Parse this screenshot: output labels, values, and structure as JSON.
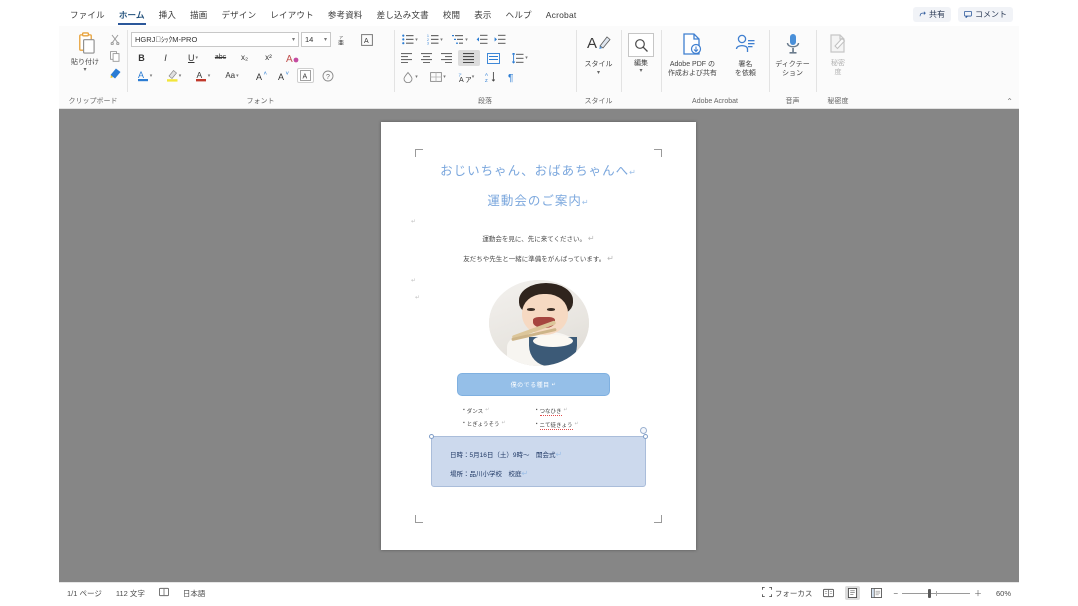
{
  "app": {
    "name": "Microsoft Word"
  },
  "tabs": [
    {
      "label": "ファイル",
      "active": false
    },
    {
      "label": "ホーム",
      "active": true
    },
    {
      "label": "挿入",
      "active": false
    },
    {
      "label": "描画",
      "active": false
    },
    {
      "label": "デザイン",
      "active": false
    },
    {
      "label": "レイアウト",
      "active": false
    },
    {
      "label": "参考資料",
      "active": false
    },
    {
      "label": "差し込み文書",
      "active": false
    },
    {
      "label": "校閲",
      "active": false
    },
    {
      "label": "表示",
      "active": false
    },
    {
      "label": "ヘルプ",
      "active": false
    },
    {
      "label": "Acrobat",
      "active": false
    }
  ],
  "tabbar_right": {
    "share_label": "共有",
    "comment_label": "コメント"
  },
  "ribbon": {
    "clipboard": {
      "group_label": "クリップボード",
      "paste_label": "貼り付け",
      "cut_name": "cut-icon",
      "copy_name": "copy-icon",
      "format_painter_name": "format-painter-icon"
    },
    "font": {
      "group_label": "フォント",
      "font_name": "HGRJ゙ｼｯｸM-PRO",
      "font_size": "14",
      "bold": "B",
      "italic": "I",
      "underline": "U",
      "strikethrough": "abc",
      "subscript": "x₂",
      "superscript": "x²",
      "text_effects": "A",
      "font_color": "A",
      "highlight": "✎",
      "char_shading": "A",
      "change_case": "Aa",
      "grow_font": "A",
      "shrink_font": "A",
      "enclose_char": "A",
      "clear_formatting": "?"
    },
    "paragraph": {
      "group_label": "段落",
      "bullets": "bullets-icon",
      "numbering": "numbering-icon",
      "multilevel": "multilevel-list-icon",
      "decrease_indent": "decrease-indent-icon",
      "increase_indent": "increase-indent-icon",
      "align_left": "align-left-icon",
      "align_center": "align-center-icon",
      "align_right": "align-right-icon",
      "justify": "justify-icon",
      "distribute": "distribute-icon",
      "line_spacing": "line-spacing-icon",
      "shading": "shading-icon",
      "borders": "borders-icon",
      "phonetic": "phonetic-guide-icon",
      "sort": "sort-icon",
      "show_marks": "show-paragraph-marks-icon"
    },
    "styles": {
      "group_label": "スタイル",
      "button_label": "スタイル"
    },
    "editing": {
      "group_label": "",
      "button_label": "編集"
    },
    "acrobat": {
      "group_label": "Adobe Acrobat",
      "create_pdf_label": "Adobe PDF の\n作成および共有",
      "create_pdf_line1": "Adobe PDF の",
      "create_pdf_line2": "作成および共有",
      "sign_line1": "署名",
      "sign_line2": "を依頼"
    },
    "voice": {
      "group_label": "音声",
      "dictate_line1": "ディクテー",
      "dictate_line2": "ション"
    },
    "sensitivity": {
      "group_label": "秘密度",
      "line1": "秘密",
      "line2": "度"
    },
    "collapse_label": "⌃"
  },
  "document": {
    "title_line1": "おじいちゃん、おばあちゃんへ",
    "title_line2": "運動会のご案内",
    "body_line1": "運動会を見に、先に来てください。",
    "body_line2": "友だちや先生と一緒に準備をがんばっています。",
    "banner_text": "僕のでる種目",
    "bullets_left": [
      "ダンス",
      "とぎょうそう"
    ],
    "bullets_right": [
      "つなひき",
      "ニて徒きょう"
    ],
    "info_line1": "日時：5月16日（土）9時～　開会式",
    "info_line2": "場所：品川小学校　校庭",
    "photo_alt": "child-eating-rice-photo"
  },
  "statusbar": {
    "page_label": "1/1 ページ",
    "word_count": "112 文字",
    "proofing_icon": "proofing-status-icon",
    "language": "日本語",
    "focus_label": "フォーカス",
    "view_read": "read-mode-icon",
    "view_print": "print-layout-icon",
    "view_web": "web-layout-icon",
    "zoom_out": "−",
    "zoom_in": "＋",
    "zoom_level": "60%"
  }
}
